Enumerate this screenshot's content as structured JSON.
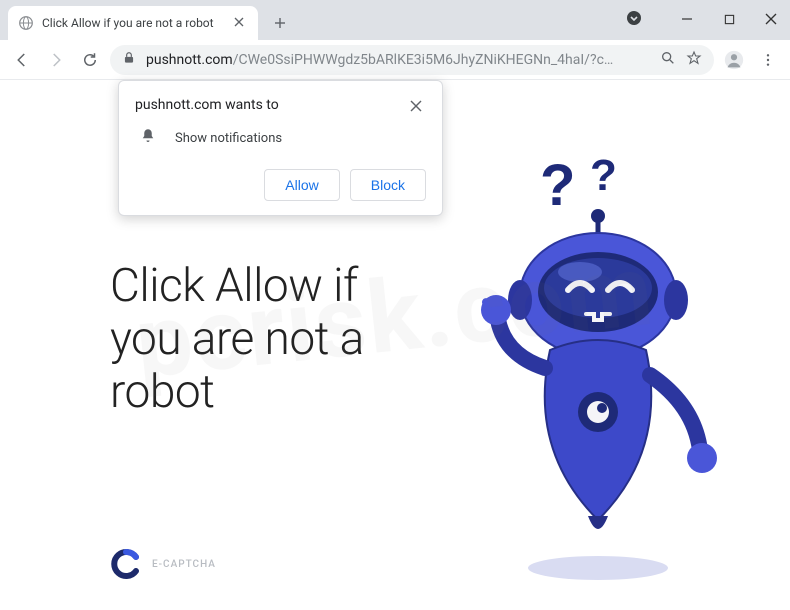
{
  "window": {
    "tab_title": "Click Allow if you are not a robot"
  },
  "toolbar": {
    "url_domain": "pushnott.com",
    "url_path": "/CWe0SsiPHWWgdz5bARlKE3i5M6JhyZNiKHEGNn_4haI/?c…"
  },
  "permission_prompt": {
    "origin_line": "pushnott.com wants to",
    "row_label": "Show notifications",
    "allow_label": "Allow",
    "block_label": "Block"
  },
  "page": {
    "hero_line1": "Click Allow if",
    "hero_line2": "you are not a",
    "hero_line3": "robot",
    "captcha_label": "E-CAPTCHA"
  },
  "watermark": "pcrisk.com"
}
